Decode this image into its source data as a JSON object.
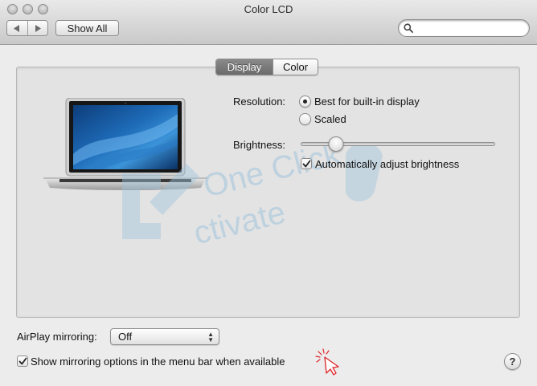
{
  "window": {
    "title": "Color LCD"
  },
  "toolbar": {
    "back_icon": "back-arrow-icon",
    "forward_icon": "forward-arrow-icon",
    "show_all_label": "Show All",
    "search_value": "",
    "search_icon": "magnifier-icon"
  },
  "tabs": [
    {
      "label": "Display",
      "selected": true
    },
    {
      "label": "Color",
      "selected": false
    }
  ],
  "display": {
    "resolution_label": "Resolution:",
    "resolution_options": [
      {
        "label": "Best for built-in display",
        "selected": true
      },
      {
        "label": "Scaled",
        "selected": false
      }
    ],
    "brightness_label": "Brightness:",
    "brightness_level": 0.18,
    "auto_brightness_label": "Automatically adjust brightness",
    "auto_brightness_checked": true
  },
  "airplay": {
    "label": "AirPlay mirroring:",
    "value": "Off"
  },
  "mirroring_menu": {
    "label": "Show mirroring options in the menu bar when available",
    "checked": true
  },
  "help_label": "?",
  "watermark": {
    "line1": "One Click",
    "line2": "ctivate",
    "color": "#9fc4dc"
  },
  "colors": {
    "window_bg": "#ececec",
    "panel_bg": "#e3e3e3",
    "tab_selected": "#7a7a7a",
    "cursor_red": "#e0262b"
  }
}
